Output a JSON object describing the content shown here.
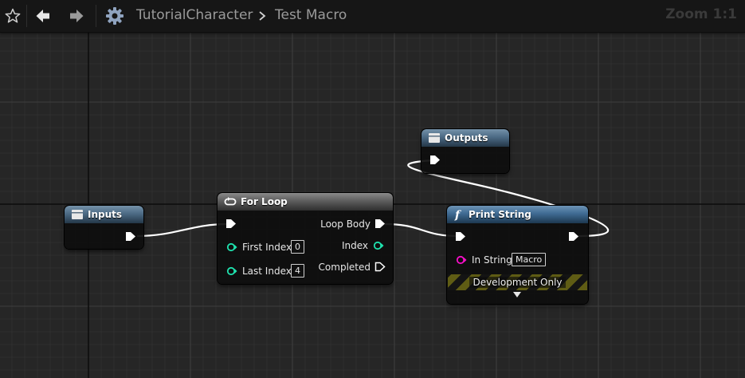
{
  "toolbar": {
    "favorite_icon": "star-icon",
    "back_icon": "back-arrow-icon",
    "forward_icon": "forward-arrow-icon",
    "blueprint_icon": "gear-icon",
    "breadcrumbs": [
      "TutorialCharacter",
      "Test Macro"
    ],
    "zoom_label": "Zoom 1:1"
  },
  "nodes": {
    "inputs": {
      "title": "Inputs",
      "icon": "tunnel-icon"
    },
    "for_loop": {
      "title": "For Loop",
      "icon": "loop-icon",
      "first_index_label": "First Index",
      "first_index_value": "0",
      "last_index_label": "Last Index",
      "last_index_value": "4",
      "loop_body_label": "Loop Body",
      "index_label": "Index",
      "completed_label": "Completed"
    },
    "outputs": {
      "title": "Outputs",
      "icon": "tunnel-icon"
    },
    "print_string": {
      "title": "Print String",
      "icon": "function-icon",
      "in_string_label": "In String",
      "in_string_value": "Macro",
      "dev_only_label": "Development Only",
      "expand_icon": "expand-arrow-icon"
    }
  },
  "colors": {
    "background": "#262626",
    "grid_minor": "#2f2f2f",
    "grid_major": "#3b3b3b",
    "grid_origin": "#0b0b0b",
    "exec_pin": "#ffffff",
    "int_pin": "#1fe3af",
    "string_pin": "#f70fc8",
    "wire_exec": "#ffffff"
  }
}
